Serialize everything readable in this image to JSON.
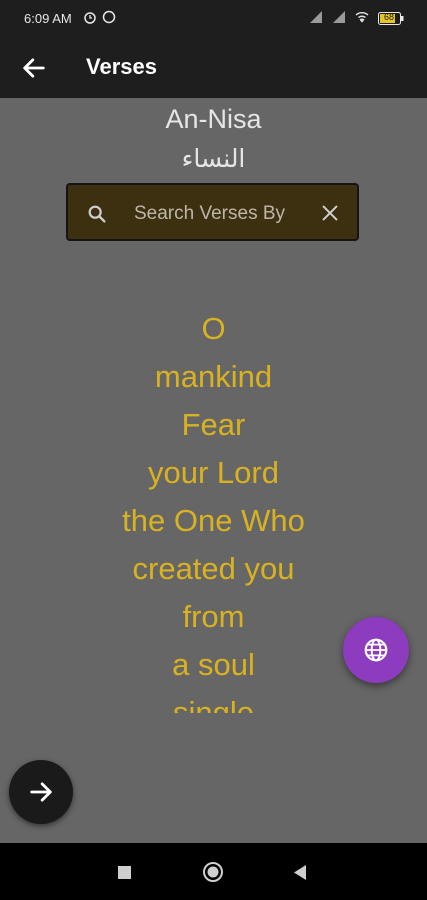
{
  "status": {
    "time": "6:09 AM",
    "battery": "68"
  },
  "appbar": {
    "title": "Verses"
  },
  "surah": {
    "name_en": "An-Nisa",
    "name_ar": "النساء"
  },
  "search": {
    "placeholder": "Search Verses By"
  },
  "verse": {
    "lines": [
      "O",
      "mankind",
      "Fear",
      "your Lord",
      "the One Who",
      "created you",
      "from",
      "a soul",
      "single"
    ]
  },
  "colors": {
    "background": "#666666",
    "appbar": "#1e1e1e",
    "verse_text": "#d9b221",
    "search_bg": "#3c3011",
    "globe_fab": "#8d3bbf"
  },
  "icons": {
    "back": "arrow-left-icon",
    "search": "search-icon",
    "clear": "close-icon",
    "language": "globe-icon",
    "next": "arrow-right-icon"
  }
}
